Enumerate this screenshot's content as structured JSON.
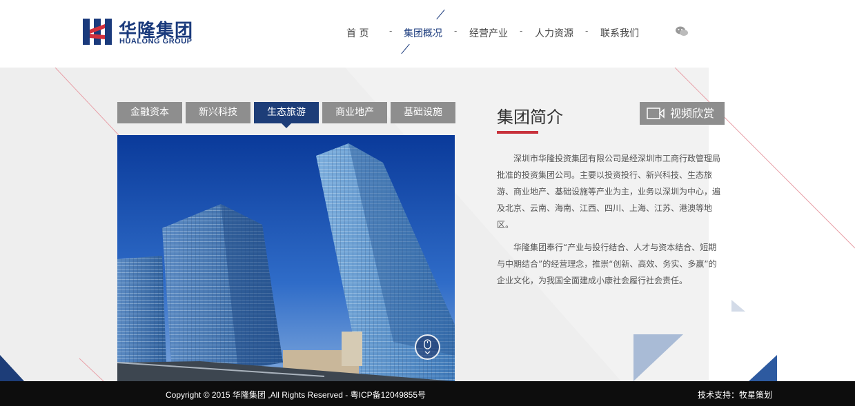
{
  "logo": {
    "cn": "华隆集团",
    "en": "HUALONG GROUP",
    "icon": "hualong-logo-mark"
  },
  "nav": {
    "items": [
      "首 页",
      "集团概况",
      "经营产业",
      "人力资源",
      "联系我们"
    ],
    "active_index": 1,
    "separator": "-",
    "wechat_icon": "wechat-icon"
  },
  "tabs": {
    "items": [
      "金融资本",
      "新兴科技",
      "生态旅游",
      "商业地产",
      "基础设施"
    ],
    "active_index": 2
  },
  "intro": {
    "title": "集团简介",
    "video_button": "视频欣赏",
    "paragraphs": [
      "深圳市华隆投资集团有限公司是经深圳市工商行政管理局批准的投资集团公司。主要以投资投行、新兴科技、生态旅游、商业地产、基础设施等产业为主，业务以深圳为中心，遍及北京、云南、海南、江西、四川、上海、江苏、港澳等地区。",
      "华隆集团奉行“产业与投行结合、人才与资本结合、短期与中期结合”的经营理念，推崇“创新、高效、务实、多赢”的企业文化，为我国全面建成小康社会履行社会责任。"
    ]
  },
  "footer": {
    "copyright": "Copyright © 2015 华隆集团 ,All Rights Reserved - 粤ICP备12049855号",
    "support": "技术支持：牧星策划"
  },
  "colors": {
    "brand_blue": "#1d3d78",
    "tab_gray": "#8e8e8e",
    "accent_red": "#c8323c",
    "footer_black": "#0d0d0d"
  }
}
